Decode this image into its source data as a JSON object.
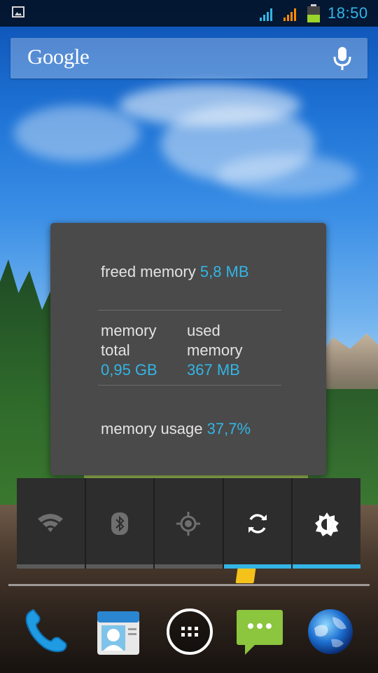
{
  "statusbar": {
    "time": "18:50",
    "icons": [
      "image-notification-icon",
      "signal-icon",
      "signal-icon",
      "battery-icon"
    ],
    "signal1_color": "#33b5e5",
    "signal2_color": "#ff8a00",
    "battery_color": "#9bd32b",
    "battery_level": 0.5
  },
  "search": {
    "logo": "Google",
    "icon": "mic-icon"
  },
  "memory": {
    "freed_label": "freed memory",
    "freed_value": "5,8 MB",
    "total_label_1": "memory",
    "total_label_2": "total",
    "total_value": "0,95 GB",
    "used_label_1": "used",
    "used_label_2": "memory",
    "used_value": "367 MB",
    "usage_label": "memory usage",
    "usage_value": "37,7%",
    "accent_color": "#33b5e5"
  },
  "quick_settings": [
    {
      "name": "wifi",
      "icon": "wifi-icon",
      "on": false
    },
    {
      "name": "bluetooth",
      "icon": "bluetooth-icon",
      "on": false
    },
    {
      "name": "gps",
      "icon": "gps-icon",
      "on": false
    },
    {
      "name": "sync",
      "icon": "sync-icon",
      "on": true
    },
    {
      "name": "brightness",
      "icon": "brightness-icon",
      "on": true
    }
  ],
  "dock": [
    {
      "name": "phone",
      "icon": "phone-icon"
    },
    {
      "name": "contacts",
      "icon": "contacts-icon"
    },
    {
      "name": "app-drawer",
      "icon": "app-drawer-icon"
    },
    {
      "name": "messaging",
      "icon": "messaging-icon"
    },
    {
      "name": "browser",
      "icon": "globe-icon"
    }
  ]
}
